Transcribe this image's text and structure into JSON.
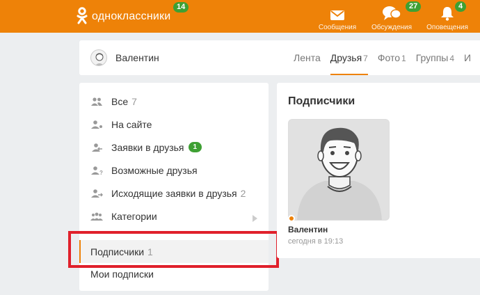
{
  "topbar": {
    "logo_text": "одноклассники",
    "logo_badge": "14",
    "nav": [
      {
        "label": "Сообщения",
        "badge": "",
        "icon": "envelope-icon"
      },
      {
        "label": "Обсуждения",
        "badge": "27",
        "icon": "chat-bubbles-icon"
      },
      {
        "label": "Оповещения",
        "badge": "4",
        "icon": "bell-icon"
      }
    ]
  },
  "profile": {
    "name": "Валентин",
    "tabs": [
      {
        "label": "Лента",
        "count": ""
      },
      {
        "label": "Друзья",
        "count": "7"
      },
      {
        "label": "Фото",
        "count": "1"
      },
      {
        "label": "Группы",
        "count": "4"
      },
      {
        "label": "И",
        "count": ""
      }
    ],
    "active_tab": "Друзья"
  },
  "menu": {
    "items": [
      {
        "label": "Все",
        "count": "7",
        "icon": "users-icon"
      },
      {
        "label": "На сайте",
        "count": "",
        "icon": "user-online-icon"
      },
      {
        "label": "Заявки в друзья",
        "badge": "1",
        "icon": "user-incoming-icon"
      },
      {
        "label": "Возможные друзья",
        "count": "",
        "icon": "user-question-icon"
      },
      {
        "label": "Исходящие заявки в друзья",
        "count": "2",
        "icon": "user-outgoing-icon"
      },
      {
        "label": "Категории",
        "count": "",
        "icon": "users-group-icon"
      }
    ],
    "subscribers": {
      "label": "Подписчики",
      "count": "1"
    },
    "my_subscriptions": {
      "label": "Мои подписки"
    }
  },
  "main": {
    "title": "Подписчики",
    "friend": {
      "name": "Валентин",
      "time": "сегодня в 19:13"
    }
  },
  "colors": {
    "accent": "#ee8208",
    "badge": "#3ea033",
    "highlight": "#e0202b"
  }
}
